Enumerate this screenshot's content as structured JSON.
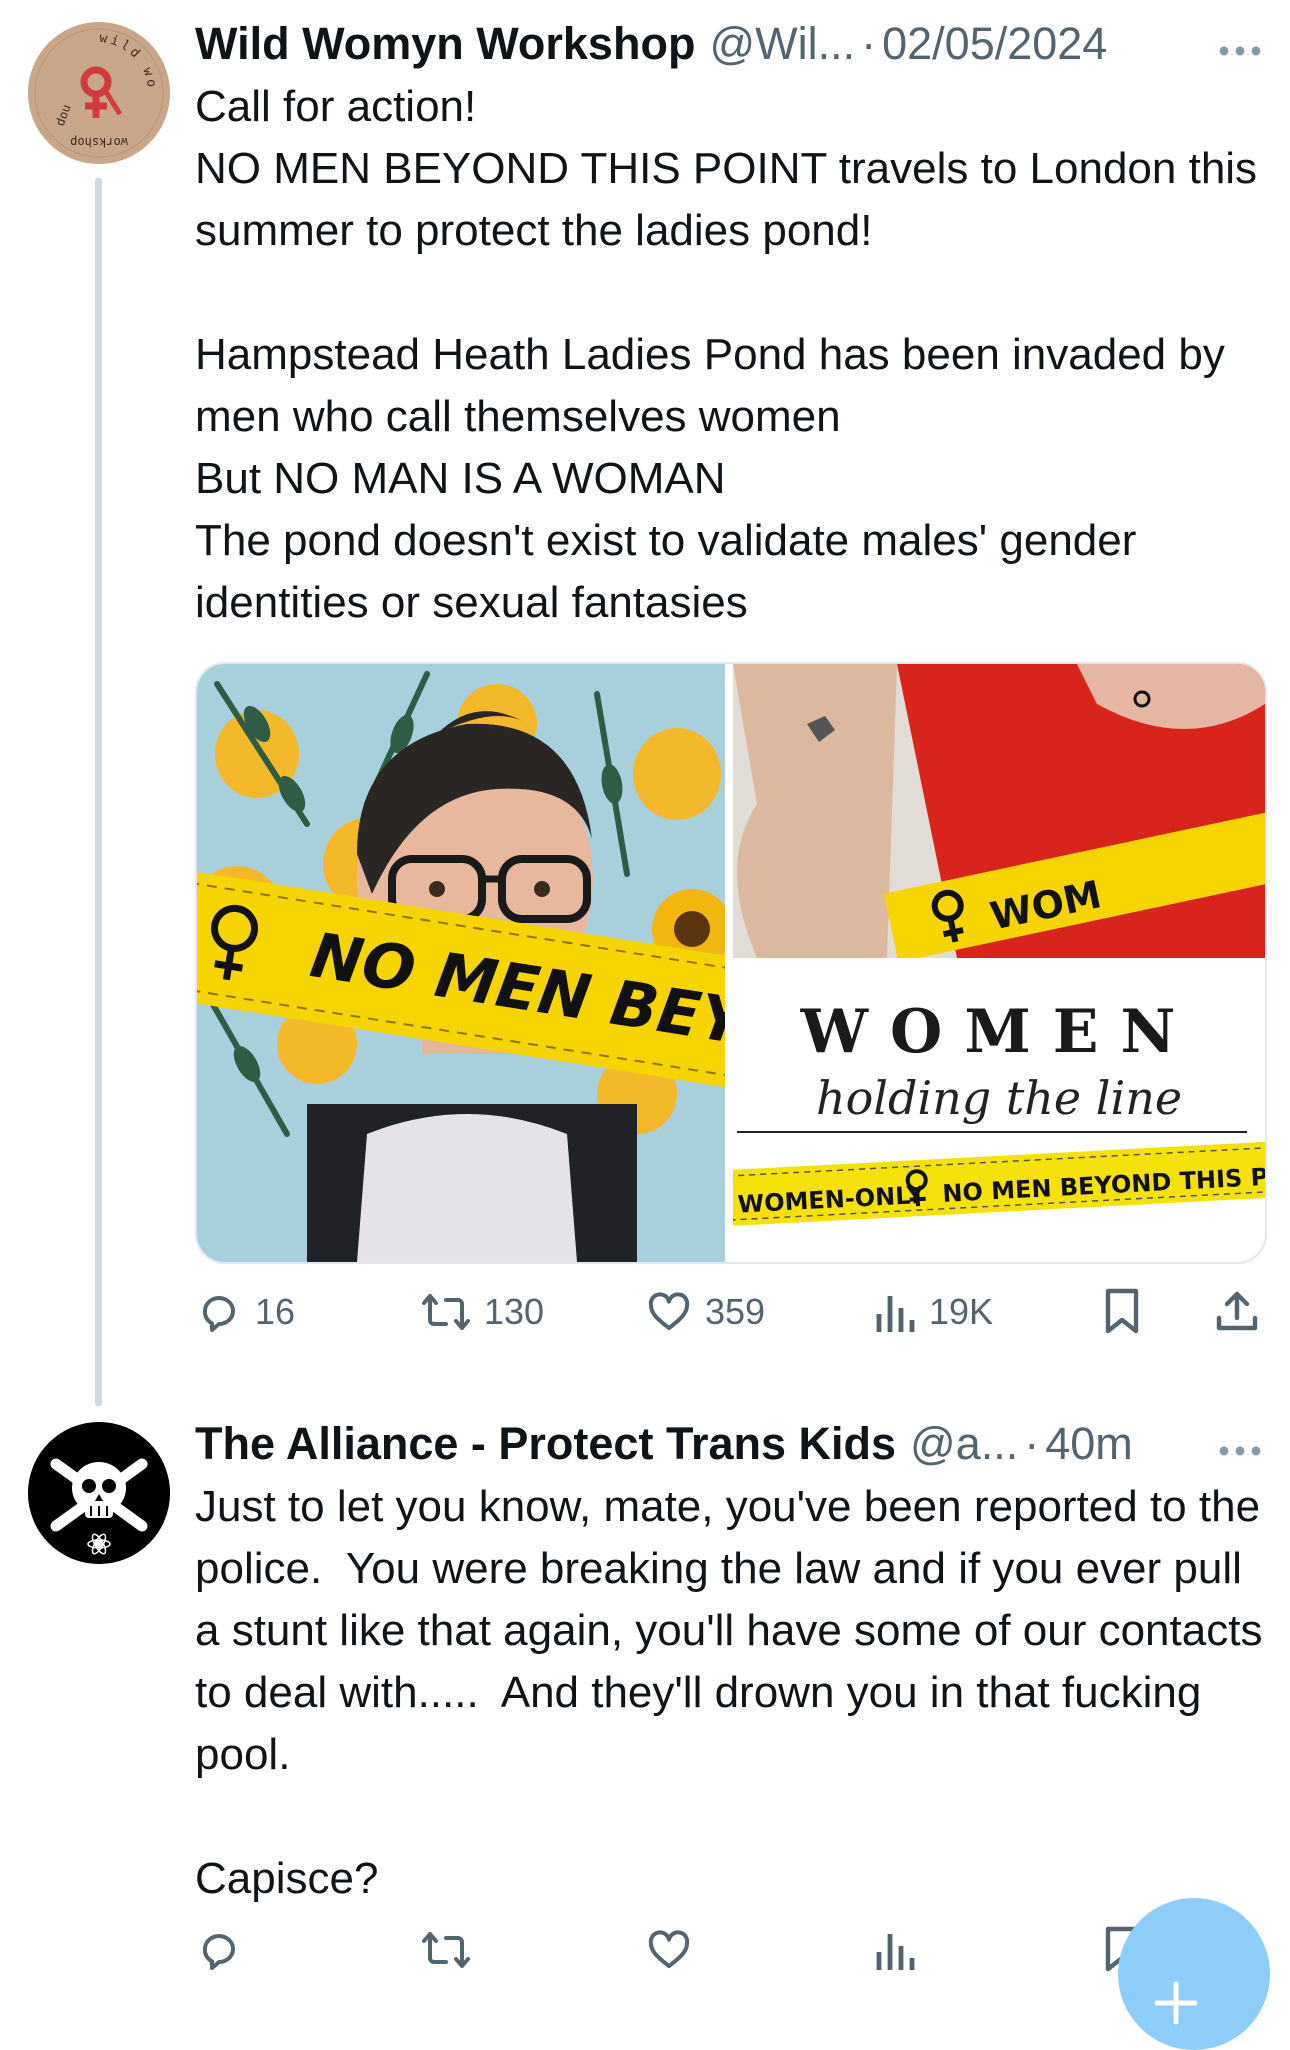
{
  "tweets": [
    {
      "author_name": "Wild Womyn Workshop",
      "handle": "@Wil...",
      "separator": "·",
      "timestamp": "02/05/2024",
      "more_icon": "more-icon",
      "avatar_text": "wild womyn workshop",
      "text": "Call for action!\nNO MEN BEYOND THIS POINT travels to London this summer to protect the ladies pond!\n\nHampstead Heath Ladies Pond has been invaded by men who call themselves women\nBut NO MAN IS A WOMAN\nThe pond doesn't exist to validate males' gender identities or sexual fantasies",
      "media": {
        "left_banner_text": "NO MEN BEY",
        "top_right_banner_text": "WOM",
        "card_title": "WOMEN",
        "card_subtitle": "holding the line",
        "card_tape_left": "WOMEN-ONLY",
        "card_tape_right": "NO MEN BEYOND THIS POINT"
      },
      "actions": {
        "replies": "16",
        "retweets": "130",
        "likes": "359",
        "views": "19K"
      }
    },
    {
      "author_name": "The Alliance - Protect Trans Kids",
      "handle": "@a...",
      "separator": "·",
      "timestamp": "40m",
      "more_icon": "more-icon",
      "text": "Just to let you know, mate, you've been reported to the police.  You were breaking the law and if you ever pull a stunt like that again, you'll have some of our contacts to deal with.....  And they'll drown you in that fucking pool.\n\nCapisce?",
      "actions": {
        "replies": "",
        "retweets": "",
        "likes": "",
        "views": ""
      }
    }
  ],
  "colors": {
    "text": "#0f1419",
    "secondary": "#536471",
    "thread_line": "#cfd9de",
    "fab": "#8ecdf8",
    "tape_yellow": "#f5d400",
    "red_shirt": "#e01b1b"
  },
  "icons": [
    "reply-icon",
    "retweet-icon",
    "like-icon",
    "views-icon",
    "bookmark-icon",
    "share-icon",
    "compose-icon"
  ]
}
